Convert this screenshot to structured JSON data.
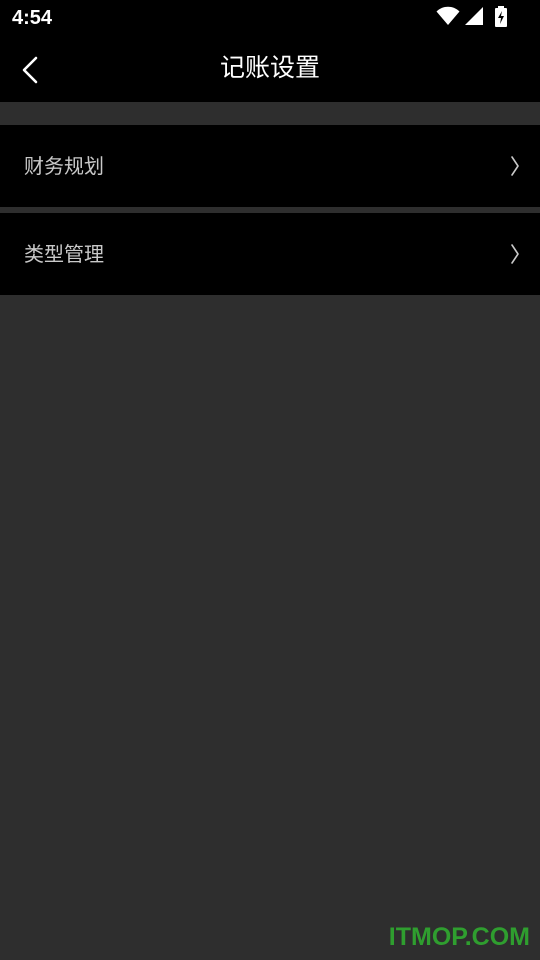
{
  "status_bar": {
    "time": "4:54",
    "icons": [
      "wifi-icon",
      "cell-signal-icon",
      "battery-charging-icon"
    ]
  },
  "app_bar": {
    "title": "记账设置",
    "back_icon": "chevron-left-icon"
  },
  "menu": {
    "items": [
      {
        "label": "财务规划",
        "chevron": "chevron-right-icon"
      },
      {
        "label": "类型管理",
        "chevron": "chevron-right-icon"
      }
    ]
  },
  "watermark": {
    "text": "ITMOP.COM",
    "color": "#2f9e2f"
  },
  "colors": {
    "background": "#2e2e2e",
    "bar": "#000000",
    "title_text": "#ffffff",
    "menu_text": "#c9c9c9"
  }
}
